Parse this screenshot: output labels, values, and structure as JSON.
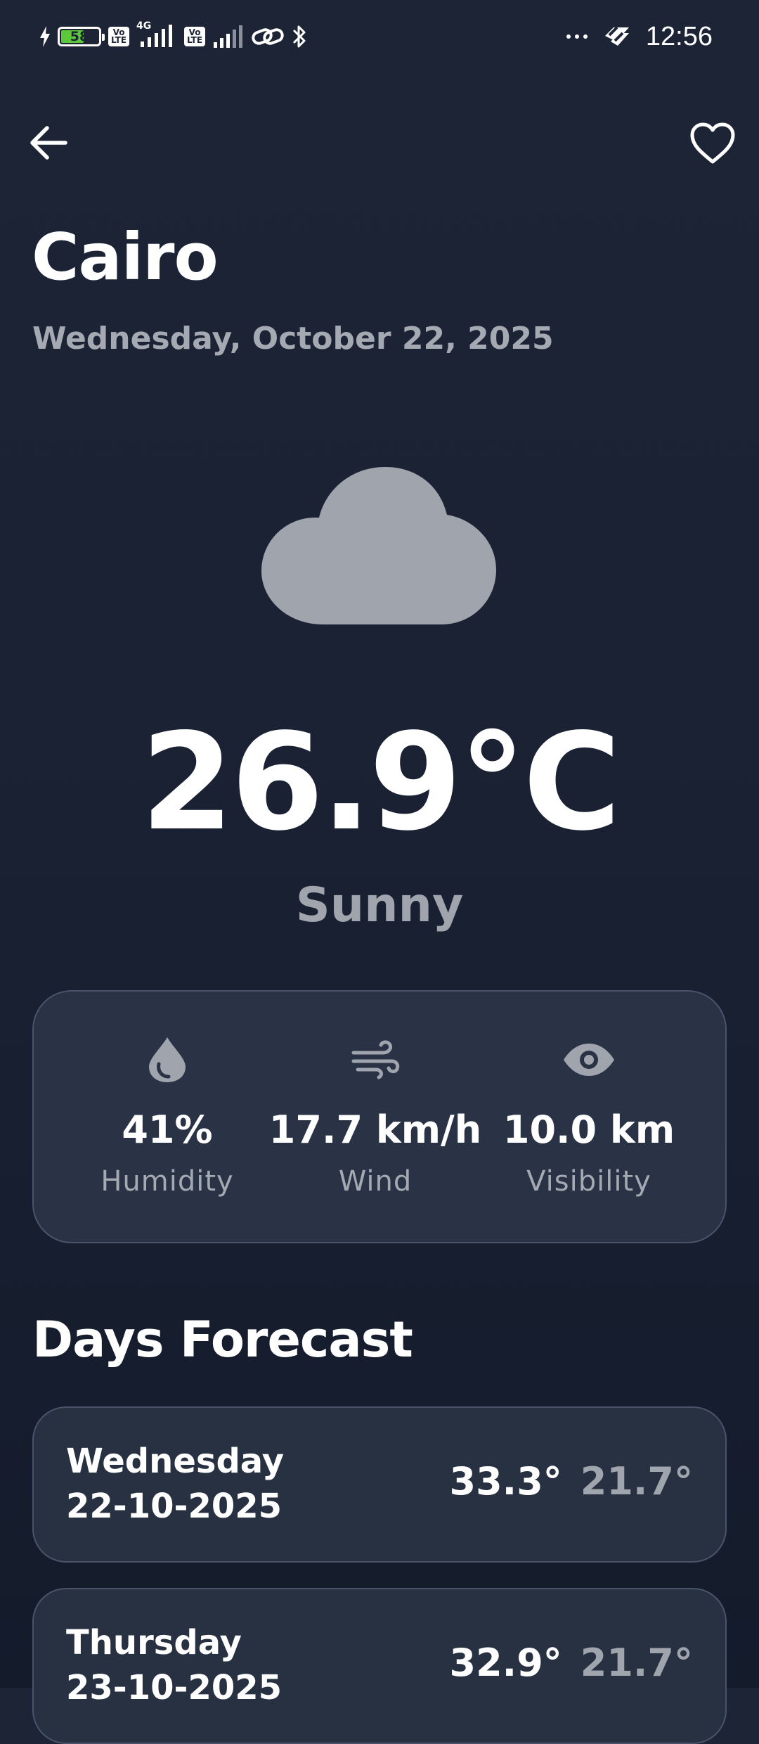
{
  "status_bar": {
    "battery_level": "58",
    "volte_label": "Vo LTE",
    "network_label": "4G",
    "time": "12:56",
    "icons": [
      "charging-icon",
      "battery-icon",
      "volte-icon",
      "signal-icon",
      "link-icon",
      "bluetooth-icon",
      "more-icon",
      "wifi-icon"
    ]
  },
  "header": {
    "back_icon": "arrow-left-icon",
    "favorite_icon": "heart-outline-icon"
  },
  "location": {
    "city": "Cairo",
    "date": "Wednesday, October 22, 2025"
  },
  "current": {
    "icon": "cloud-icon",
    "temperature": "26.9°C",
    "condition": "Sunny"
  },
  "stats": [
    {
      "icon": "droplet-icon",
      "value": "41%",
      "label": "Humidity"
    },
    {
      "icon": "wind-icon",
      "value": "17.7 km/h",
      "label": "Wind"
    },
    {
      "icon": "eye-icon",
      "value": "10.0 km",
      "label": "Visibility"
    }
  ],
  "forecast": {
    "title": "Days Forecast",
    "days": [
      {
        "day": "Wednesday",
        "date": "22-10-2025",
        "high": "33.3°",
        "low": "21.7°"
      },
      {
        "day": "Thursday",
        "date": "23-10-2025",
        "high": "32.9°",
        "low": "21.7°"
      }
    ]
  },
  "colors": {
    "background": "#1c2436",
    "card": "#293345",
    "card_border": "#49536a",
    "secondary_text": "#a4a9b2",
    "icon_gray": "#a0a4ad",
    "battery_green": "#5cc93a"
  }
}
